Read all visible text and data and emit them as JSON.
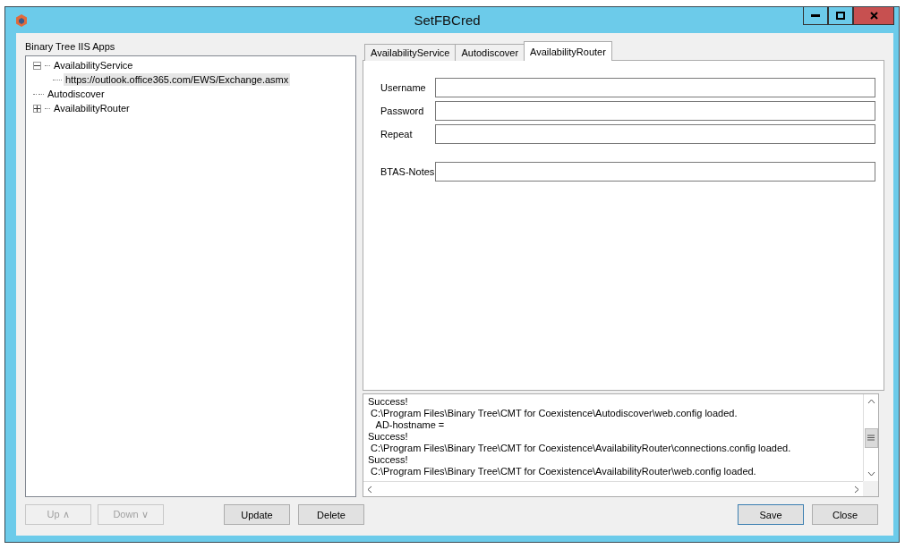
{
  "window": {
    "title": "SetFBCred"
  },
  "tree": {
    "label": "Binary Tree IIS Apps",
    "items": [
      {
        "label": "AvailabilityService",
        "expanded": true,
        "selected": false,
        "children": [
          {
            "label": "https://outlook.office365.com/EWS/Exchange.asmx",
            "selected": true
          }
        ]
      },
      {
        "label": "Autodiscover",
        "selected": false
      },
      {
        "label": "AvailabilityRouter",
        "expanded": false,
        "selected": false
      }
    ]
  },
  "left_buttons": [
    {
      "label": "Up ∧",
      "disabled": true
    },
    {
      "label": "Down ∨",
      "disabled": true
    },
    {
      "label": "Update",
      "disabled": false
    },
    {
      "label": "Delete",
      "disabled": false
    }
  ],
  "tabs": [
    {
      "label": "AvailabilityService",
      "selected": false
    },
    {
      "label": "Autodiscover",
      "selected": false
    },
    {
      "label": "AvailabilityRouter",
      "selected": true
    }
  ],
  "fields": [
    {
      "label": "Username"
    },
    {
      "label": "Password"
    },
    {
      "label": "Repeat"
    },
    {
      "label": "BTAS-Notes"
    }
  ],
  "log": [
    "Success!",
    " C:\\Program Files\\Binary Tree\\CMT for Coexistence\\Autodiscover\\web.config loaded.",
    "   AD-hostname =",
    "Success!",
    " C:\\Program Files\\Binary Tree\\CMT for Coexistence\\AvailabilityRouter\\connections.config loaded.",
    "Success!",
    " C:\\Program Files\\Binary Tree\\CMT for Coexistence\\AvailabilityRouter\\web.config loaded."
  ],
  "right_buttons": [
    {
      "label": "Save",
      "default": true
    },
    {
      "label": "Close",
      "default": false
    }
  ]
}
